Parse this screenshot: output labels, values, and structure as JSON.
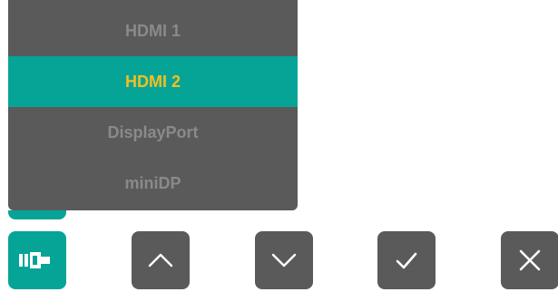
{
  "input_menu": {
    "items": [
      {
        "label": "HDMI 1",
        "selected": false
      },
      {
        "label": "HDMI 2",
        "selected": true
      },
      {
        "label": "DisplayPort",
        "selected": false
      },
      {
        "label": "miniDP",
        "selected": false
      }
    ]
  },
  "buttons": [
    {
      "name": "input-source-button",
      "icon": "input-source-icon"
    },
    {
      "name": "up-button",
      "icon": "chevron-up-icon"
    },
    {
      "name": "down-button",
      "icon": "chevron-down-icon"
    },
    {
      "name": "confirm-button",
      "icon": "checkmark-icon"
    },
    {
      "name": "close-button",
      "icon": "close-icon"
    }
  ],
  "colors": {
    "menu_background": "#5a5a5a",
    "accent": "#06a497",
    "selected_text": "#f0c020",
    "item_text": "#8a8a8a",
    "button_background": "#5a5a5a"
  }
}
